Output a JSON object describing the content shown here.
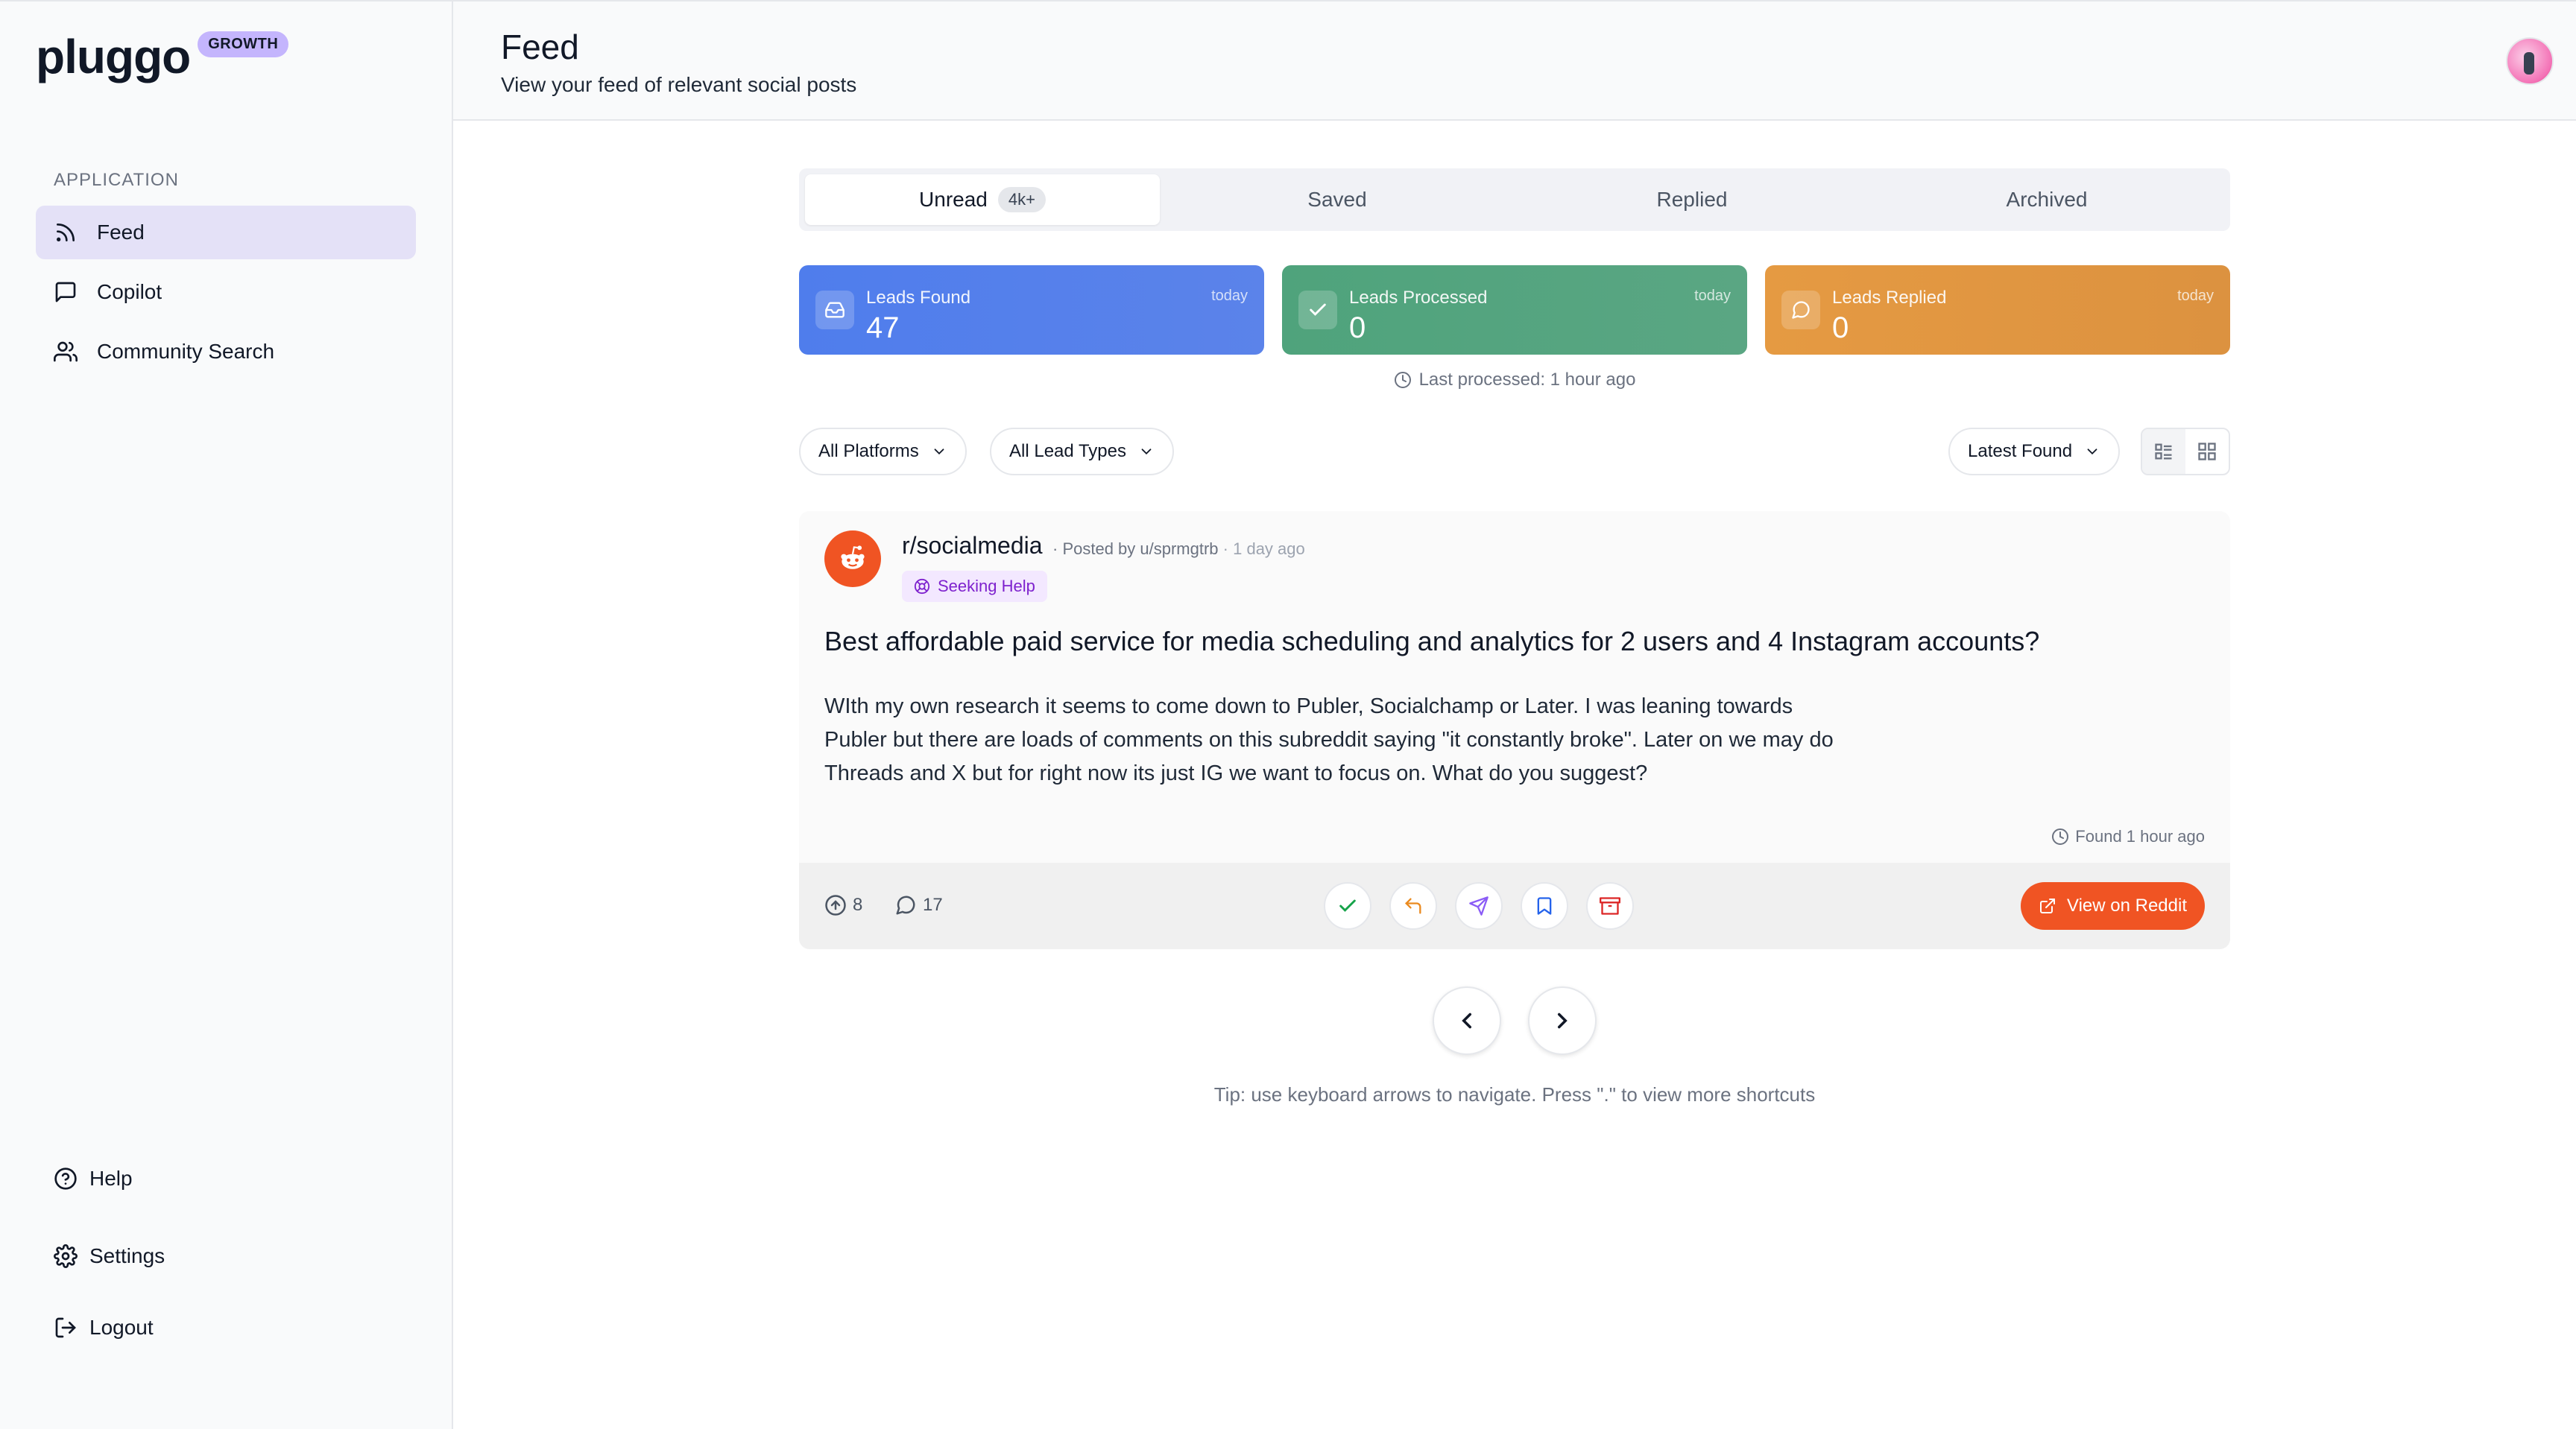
{
  "brand": {
    "name": "pluggo",
    "badge": "GROWTH"
  },
  "sidebar": {
    "section_label": "APPLICATION",
    "items": [
      {
        "label": "Feed",
        "icon": "rss-icon",
        "active": true
      },
      {
        "label": "Copilot",
        "icon": "message-square-icon",
        "active": false
      },
      {
        "label": "Community Search",
        "icon": "users-icon",
        "active": false
      }
    ],
    "bottom": [
      {
        "label": "Help",
        "icon": "help-circle-icon"
      },
      {
        "label": "Settings",
        "icon": "gear-icon"
      },
      {
        "label": "Logout",
        "icon": "logout-icon"
      }
    ]
  },
  "header": {
    "title": "Feed",
    "subtitle": "View your feed of relevant social posts"
  },
  "tabs": [
    {
      "label": "Unread",
      "badge": "4k+",
      "active": true
    },
    {
      "label": "Saved",
      "active": false
    },
    {
      "label": "Replied",
      "active": false
    },
    {
      "label": "Archived",
      "active": false
    }
  ],
  "stats": [
    {
      "label": "Leads Found",
      "value": "47",
      "when": "today",
      "color": "#4f7dec",
      "icon": "inbox-icon"
    },
    {
      "label": "Leads Processed",
      "value": "0",
      "when": "today",
      "color": "#4fa37c",
      "icon": "check-icon"
    },
    {
      "label": "Leads Replied",
      "value": "0",
      "when": "today",
      "color": "#e59a42",
      "icon": "message-circle-icon"
    }
  ],
  "last_processed": "Last processed: 1 hour ago",
  "filters": {
    "platform": "All Platforms",
    "lead_type": "All Lead Types",
    "sort": "Latest Found"
  },
  "post": {
    "platform": "reddit",
    "subreddit": "r/socialmedia",
    "posted_by": "· Posted by u/sprmgtrb",
    "ago": "· 1 day ago",
    "tag": "Seeking Help",
    "title": "Best affordable paid service for media scheduling and analytics for 2 users and 4 Instagram accounts?",
    "body": "WIth my own research it seems to come down to Publer, Socialchamp or Later. I was leaning towards Publer but there are loads of comments on this subreddit saying \"it constantly broke\". Later on we may do Threads and X but for right now its just IG we want to focus on. What do you suggest?",
    "found": "Found 1 hour ago",
    "upvotes": "8",
    "comments": "17",
    "view_label": "View on Reddit"
  },
  "tip": "Tip: use keyboard arrows to navigate. Press \".\" to view more shortcuts",
  "colors": {
    "reddit": "#f05423",
    "accent": "#e4e1f7",
    "tag_text": "#7e22ce"
  }
}
